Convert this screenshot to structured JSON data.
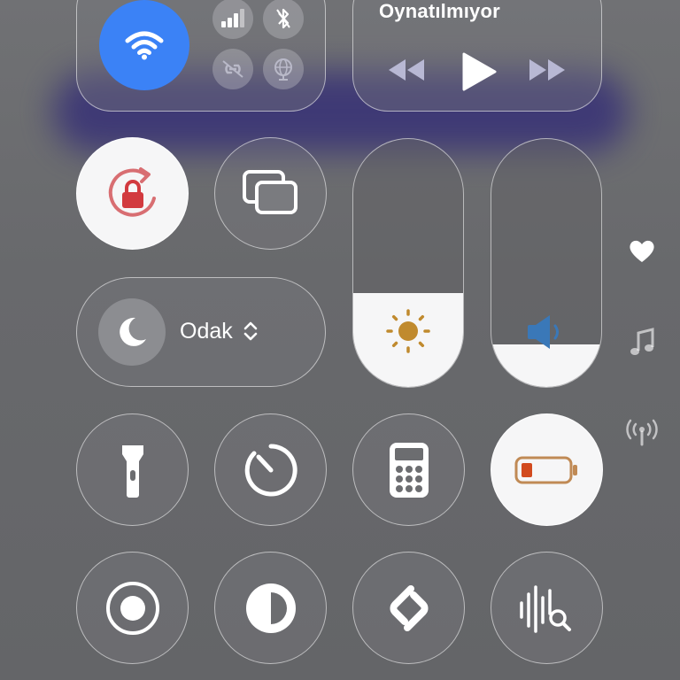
{
  "media": {
    "title": "Oynatılmıyor"
  },
  "focus": {
    "label": "Odak"
  },
  "sliders": {
    "brightness_level_percent": 38,
    "volume_level_percent": 17
  },
  "colors": {
    "wifi_active": "#3b82f6",
    "lock_rotation": "#d23a3f",
    "brightness_sun": "#c08a2e",
    "volume_speaker": "#3a78b8",
    "battery_low": "#d24a1e",
    "glow": "#3a3476"
  },
  "icons": [
    "wifi-icon",
    "cellular-icon",
    "bluetooth-icon",
    "personal-hotspot-icon",
    "globe-icon",
    "rewind-icon",
    "play-icon",
    "fast-forward-icon",
    "orientation-lock-icon",
    "screen-mirroring-icon",
    "sun-icon",
    "speaker-icon",
    "moon-icon",
    "flashlight-icon",
    "timer-icon",
    "calculator-icon",
    "battery-icon",
    "screen-record-icon",
    "dark-mode-icon",
    "shazam-icon",
    "sound-recognition-icon",
    "heart-icon",
    "music-note-icon",
    "antenna-icon"
  ]
}
